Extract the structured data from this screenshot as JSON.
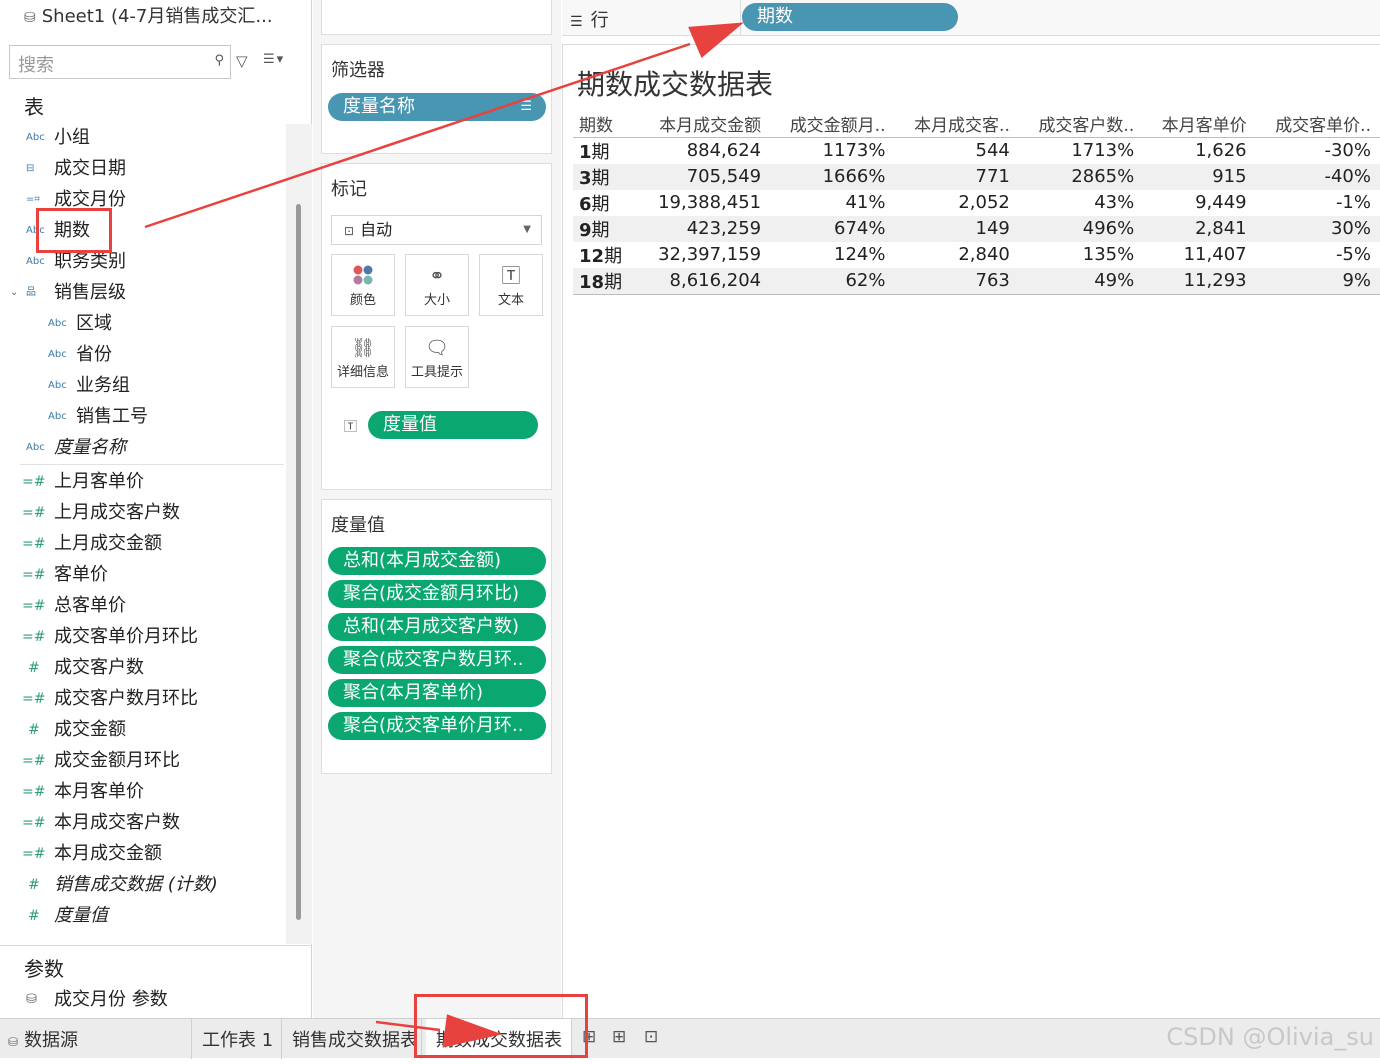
{
  "datasource": {
    "title": "Sheet1 (4-7月销售成交汇..."
  },
  "search": {
    "placeholder": "搜索"
  },
  "sections": {
    "tables": "表",
    "params": "参数"
  },
  "dimensions": [
    {
      "type": "Abc",
      "label": "小组",
      "indent": 0
    },
    {
      "type": "cal",
      "label": "成交日期",
      "indent": 0
    },
    {
      "type": "calc",
      "label": "成交月份",
      "indent": 0
    },
    {
      "type": "Abc",
      "label": "期数",
      "indent": 0
    },
    {
      "type": "Abc",
      "label": "职务类别",
      "indent": 0
    },
    {
      "type": "hier",
      "label": "销售层级",
      "indent": 0
    },
    {
      "type": "Abc",
      "label": "区域",
      "indent": 1
    },
    {
      "type": "Abc",
      "label": "省份",
      "indent": 1
    },
    {
      "type": "Abc",
      "label": "业务组",
      "indent": 1
    },
    {
      "type": "Abc",
      "label": "销售工号",
      "indent": 1
    },
    {
      "type": "Abc",
      "label": "度量名称",
      "indent": 0,
      "italic": true
    }
  ],
  "measures": [
    {
      "type": "calc",
      "label": "上月客单价"
    },
    {
      "type": "calc",
      "label": "上月成交客户数"
    },
    {
      "type": "calc",
      "label": "上月成交金额"
    },
    {
      "type": "calc",
      "label": "客单价"
    },
    {
      "type": "calc",
      "label": "总客单价"
    },
    {
      "type": "calc",
      "label": "成交客单价月环比"
    },
    {
      "type": "num",
      "label": "成交客户数"
    },
    {
      "type": "calc",
      "label": "成交客户数月环比"
    },
    {
      "type": "num",
      "label": "成交金额"
    },
    {
      "type": "calc",
      "label": "成交金额月环比"
    },
    {
      "type": "calc",
      "label": "本月客单价"
    },
    {
      "type": "calc",
      "label": "本月成交客户数"
    },
    {
      "type": "calc",
      "label": "本月成交金额"
    },
    {
      "type": "num",
      "label": "销售成交数据 (计数)",
      "italic": true
    },
    {
      "type": "num",
      "label": "度量值",
      "italic": true
    }
  ],
  "parameters": [
    {
      "label": "成交月份 参数"
    }
  ],
  "filters": {
    "title": "筛选器",
    "pill": "度量名称"
  },
  "marks": {
    "title": "标记",
    "type": "自动",
    "buttons": [
      {
        "icon": "color-icon",
        "label": "颜色"
      },
      {
        "icon": "size-icon",
        "label": "大小"
      },
      {
        "icon": "text-icon",
        "label": "文本"
      },
      {
        "icon": "detail-icon",
        "label": "详细信息"
      },
      {
        "icon": "tooltip-icon",
        "label": "工具提示"
      }
    ],
    "text_pill": "度量值"
  },
  "measure_values": {
    "title": "度量值",
    "pills": [
      "总和(本月成交金额)",
      "聚合(成交金额月环比)",
      "总和(本月成交客户数)",
      "聚合(成交客户数月环..",
      "聚合(本月客单价)",
      "聚合(成交客单价月环.."
    ]
  },
  "rows_shelf": {
    "label": "行",
    "pill": "期数"
  },
  "view": {
    "title": "期数成交数据表",
    "columns": [
      "期数",
      "本月成交金额",
      "成交金额月..",
      "本月成交客..",
      "成交客户数..",
      "本月客单价",
      "成交客单价.."
    ],
    "rows": [
      {
        "num": "1",
        "suffix": "期",
        "cells": [
          "884,624",
          "1173%",
          "544",
          "1713%",
          "1,626",
          "-30%"
        ]
      },
      {
        "num": "3",
        "suffix": "期",
        "cells": [
          "705,549",
          "1666%",
          "771",
          "2865%",
          "915",
          "-40%"
        ]
      },
      {
        "num": "6",
        "suffix": "期",
        "cells": [
          "19,388,451",
          "41%",
          "2,052",
          "43%",
          "9,449",
          "-1%"
        ]
      },
      {
        "num": "9",
        "suffix": "期",
        "cells": [
          "423,259",
          "674%",
          "149",
          "496%",
          "2,841",
          "30%"
        ]
      },
      {
        "num": "12",
        "suffix": "期",
        "cells": [
          "32,397,159",
          "124%",
          "2,840",
          "135%",
          "11,407",
          "-5%"
        ]
      },
      {
        "num": "18",
        "suffix": "期",
        "cells": [
          "8,616,204",
          "62%",
          "763",
          "49%",
          "11,293",
          "9%"
        ]
      }
    ]
  },
  "tabs": {
    "datasource": "数据源",
    "sheets": [
      "工作表 1",
      "销售成交数据表",
      "期数成交数据表"
    ],
    "active": 2
  },
  "watermark": "CSDN @Olivia_su",
  "colors": {
    "pill_blue": "#4996b2",
    "pill_green": "#0aa870",
    "annotation_red": "#e8423f"
  }
}
